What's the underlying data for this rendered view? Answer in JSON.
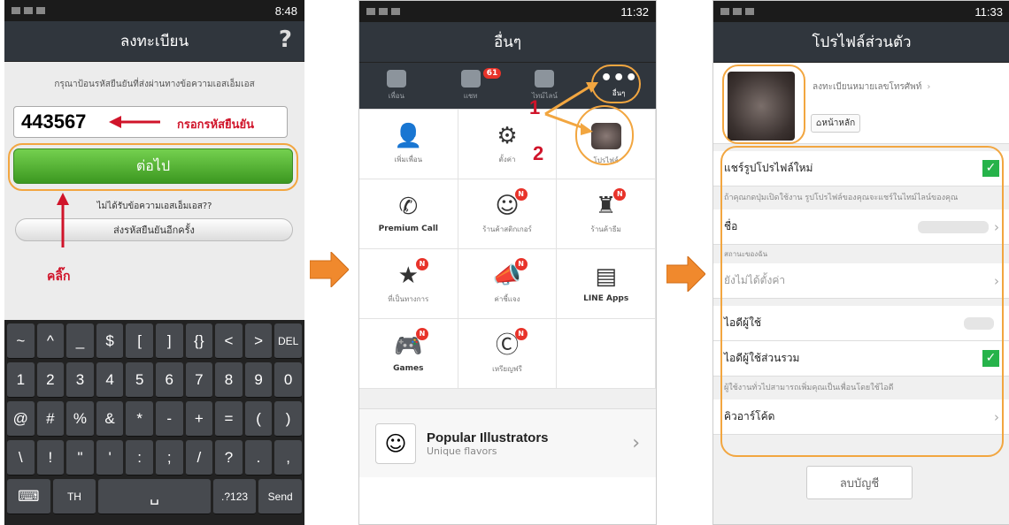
{
  "phone1": {
    "time": "8:48",
    "title": "ลงทะเบียน",
    "help": "?",
    "instruction": "กรุณาป้อนรหัสยืนยันที่ส่งผ่านทางข้อความเอสเอ็มเอส",
    "code": "443567",
    "annot_code": "กรอกรหัสยืนยัน",
    "next_label": "ต่อไป",
    "no_receive": "ไม่ได้รับข้อความเอสเอ็มเอส??",
    "resend_label": "ส่งรหัสยืนยันอีกครั้ง",
    "annot_click": "คลิ๊ก",
    "keys": [
      [
        "~",
        "^",
        "_",
        "$",
        "[",
        "]",
        "{}",
        "<",
        ">",
        "DEL"
      ],
      [
        "1",
        "2",
        "3",
        "4",
        "5",
        "6",
        "7",
        "8",
        "9",
        "0"
      ],
      [
        "@",
        "#",
        "%",
        "&",
        "*",
        "-",
        "+",
        "=",
        "(",
        ")"
      ],
      [
        "\\",
        "!",
        "\"",
        "'",
        ":",
        ";",
        "/",
        "?",
        ".",
        ","
      ],
      [
        "⌨",
        "TH",
        "␣",
        ".?123",
        "Send"
      ]
    ]
  },
  "phone2": {
    "time": "11:32",
    "title": "อื่นๆ",
    "tabs": [
      {
        "label": "เพื่อน"
      },
      {
        "label": "แชท",
        "badge": "61"
      },
      {
        "label": "ไทม์ไลน์"
      },
      {
        "label": "อื่นๆ",
        "icon": "•••"
      }
    ],
    "step1": "1",
    "step2": "2",
    "grid": [
      {
        "label": "เพิ่มเพื่อน",
        "icon": "👤"
      },
      {
        "label": "ตั้งค่า",
        "icon": "⚙"
      },
      {
        "label": "โปรไฟล์",
        "icon": "▣"
      },
      {
        "label": "Premium Call",
        "icon": "✆",
        "bold": true
      },
      {
        "label": "ร้านค้าสติกเกอร์",
        "icon": "☺",
        "badge": "N"
      },
      {
        "label": "ร้านค้าธีม",
        "icon": "♜",
        "badge": "N"
      },
      {
        "label": "ที่เป็นทางการ",
        "icon": "★",
        "badge": "N"
      },
      {
        "label": "ค่าชี้แจง",
        "icon": "📣",
        "badge": "N"
      },
      {
        "label": "LINE Apps",
        "icon": "▤",
        "bold": true
      },
      {
        "label": "Games",
        "icon": "🎮",
        "badge": "N",
        "bold": true
      },
      {
        "label": "เหรียญฟรี",
        "icon": "Ⓒ",
        "badge": "N"
      },
      {
        "label": "",
        "icon": ""
      }
    ],
    "popular_title": "Popular Illustrators",
    "popular_sub": "Unique flavors"
  },
  "phone3": {
    "time": "11:33",
    "title": "โปรไฟล์ส่วนตัว",
    "register_phone": "ลงทะเบียนหมายเลขโทรศัพท์",
    "home_label": "หน้าหลัก",
    "share_profile": "แชร์รูปโปรไฟล์ใหม่",
    "share_note": "ถ้าคุณกดปุ่มเปิดใช้งาน รูปโปรไฟล์ของคุณจะแชร์ในไทม์ไลน์ของคุณ",
    "name_label": "ชื่อ",
    "status_section": "สถานะของฉัน",
    "status_value": "ยังไม่ได้ตั้งค่า",
    "user_id": "ไอดีผู้ใช้",
    "public_id": "ไอดีผู้ใช้ส่วนรวม",
    "public_note": "ผู้ใช้งานทั่วไปสามารถเพิ่มคุณเป็นเพื่อนโดยใช้ไอดี",
    "qr_code": "คิวอาร์โค้ด",
    "delete_account": "ลบบัญชี"
  }
}
